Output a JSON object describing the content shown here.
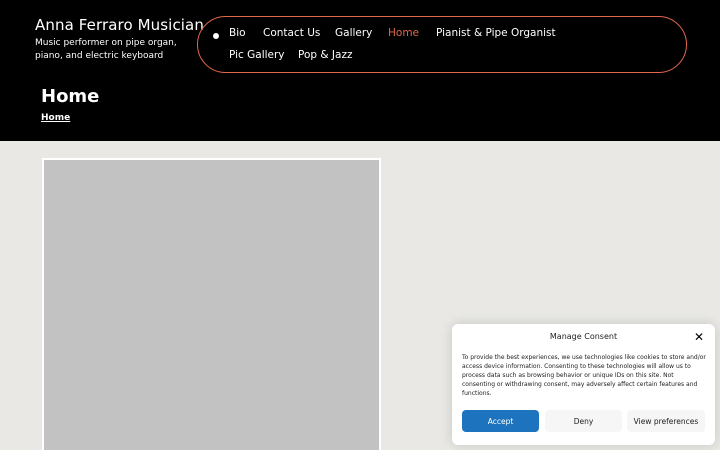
{
  "header": {
    "site_title": "Anna Ferraro Musician",
    "tagline": "Music performer on pipe organ, piano, and electric keyboard"
  },
  "nav": {
    "items": [
      {
        "label": "Bio"
      },
      {
        "label": "Contact Us"
      },
      {
        "label": "Gallery"
      },
      {
        "label": "Home",
        "active": true
      },
      {
        "label": "Pianist & Pipe Organist"
      },
      {
        "label": "Pic Gallery"
      },
      {
        "label": "Pop & Jazz"
      }
    ]
  },
  "page": {
    "title": "Home",
    "breadcrumb": "Home"
  },
  "consent": {
    "title": "Manage Consent",
    "body": "To provide the best experiences, we use technologies like cookies to store and/or access device information. Consenting to these technologies will allow us to process data such as browsing behavior or unique IDs on this site. Not consenting or withdrawing consent, may adversely affect certain features and functions.",
    "accept_label": "Accept",
    "deny_label": "Deny",
    "preferences_label": "View preferences",
    "close_glyph": "✕"
  },
  "colors": {
    "header_bg": "#000000",
    "accent": "#e2674d",
    "page_bg": "#e9e8e4",
    "accept_button": "#1e73be"
  }
}
